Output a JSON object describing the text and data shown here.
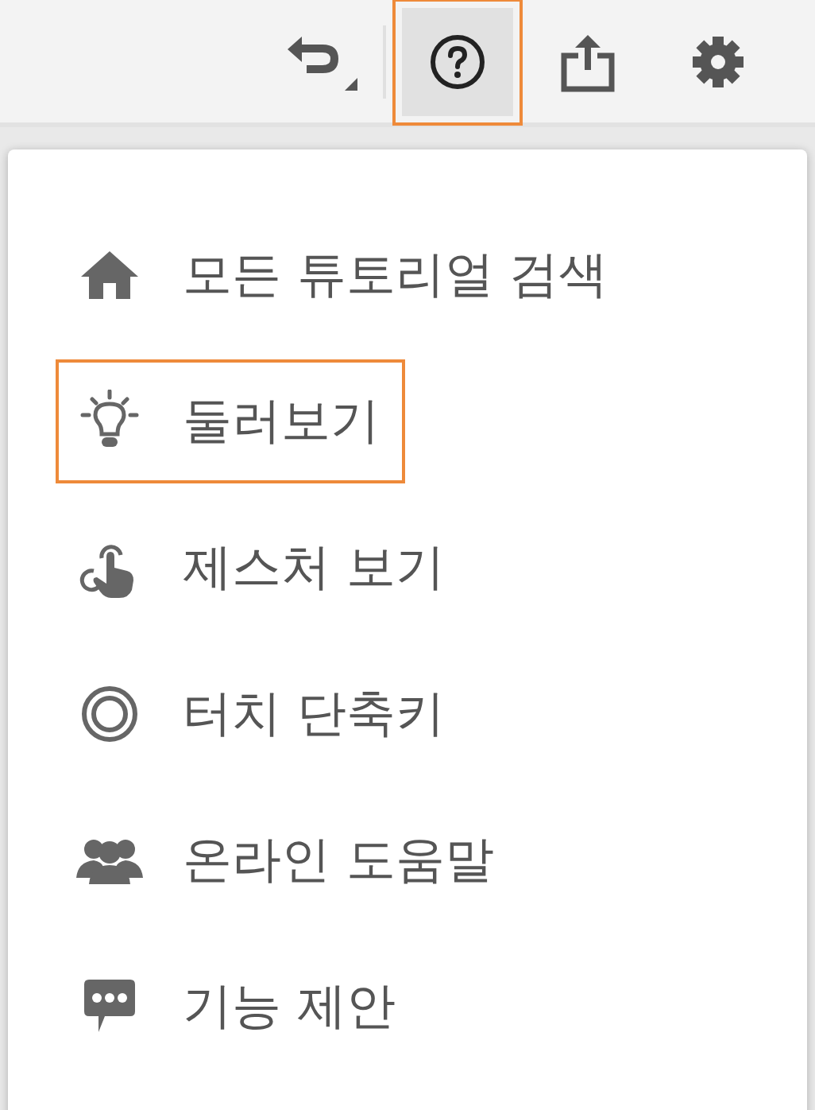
{
  "toolbar": {
    "buttons": [
      {
        "kind": "undo",
        "selected": false
      },
      {
        "kind": "help",
        "selected": true
      },
      {
        "kind": "share",
        "selected": false
      },
      {
        "kind": "settings",
        "selected": false
      }
    ]
  },
  "menu": {
    "items": [
      {
        "kind": "home",
        "label": "모든 튜토리얼 검색",
        "selected": false
      },
      {
        "kind": "bulb",
        "label": "둘러보기",
        "selected": true
      },
      {
        "kind": "gesture",
        "label": "제스처 보기",
        "selected": false
      },
      {
        "kind": "ring",
        "label": "터치 단축키",
        "selected": false
      },
      {
        "kind": "people",
        "label": "온라인 도움말",
        "selected": false
      },
      {
        "kind": "chat",
        "label": "기능 제안",
        "selected": false
      }
    ]
  }
}
